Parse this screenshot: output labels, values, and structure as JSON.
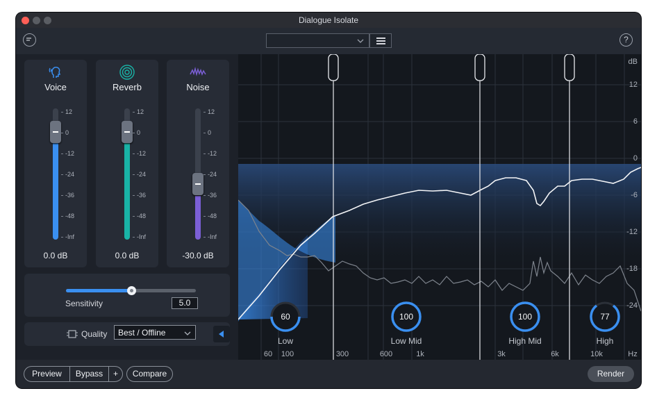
{
  "window": {
    "title": "Dialogue Isolate"
  },
  "toolbar": {
    "preset_value": ""
  },
  "cards": [
    {
      "label": "Voice",
      "value": "0.0 dB",
      "color": "#3a8ff0",
      "icon": "voice-icon"
    },
    {
      "label": "Reverb",
      "value": "0.0 dB",
      "color": "#19b3a6",
      "icon": "reverb-icon"
    },
    {
      "label": "Noise",
      "value": "-30.0 dB",
      "color": "#7b5fd6",
      "icon": "noise-icon"
    }
  ],
  "meter_scale": [
    "12",
    "0",
    "-12",
    "-24",
    "-36",
    "-48",
    "-Inf"
  ],
  "sensitivity": {
    "label": "Sensitivity",
    "value": "5.0"
  },
  "quality": {
    "label": "Quality",
    "selected": "Best / Offline"
  },
  "graph": {
    "db_unit": "dB",
    "db_labels": [
      "12",
      "6",
      "0",
      "-6",
      "-12",
      "-18",
      "-24"
    ],
    "freq_labels": [
      "60",
      "100",
      "300",
      "600",
      "1k",
      "3k",
      "6k",
      "10k",
      "Hz"
    ],
    "bands": [
      {
        "name": "Low",
        "value": "60"
      },
      {
        "name": "Low Mid",
        "value": "100"
      },
      {
        "name": "High Mid",
        "value": "100"
      },
      {
        "name": "High",
        "value": "77"
      }
    ]
  },
  "bottom": {
    "preview": "Preview",
    "bypass": "Bypass",
    "add": "+",
    "compare": "Compare",
    "render": "Render"
  },
  "colors": {
    "accent": "#3a8ff0",
    "background": "#1d2129"
  }
}
